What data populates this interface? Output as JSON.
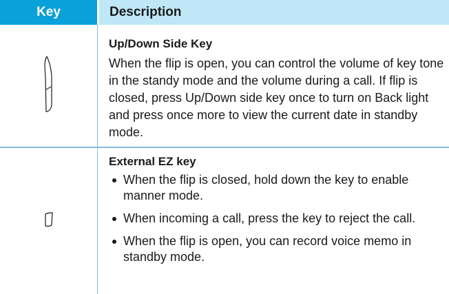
{
  "table": {
    "header": {
      "key": "Key",
      "description": "Description"
    },
    "rows": [
      {
        "icon": "up-down-side-key-icon",
        "title": "Up/Down Side Key",
        "body": "When the flip is open, you can control the volume of key tone in the standy mode and the volume during a call. If flip is closed, press Up/Down side key once to turn on Back light and press once more to view the current date in standby mode."
      },
      {
        "icon": "external-ez-key-icon",
        "title": "External EZ key",
        "bullets": [
          "When the flip is closed, hold down the key to enable manner mode.",
          "When incoming a call, press the key to reject the call.",
          "When the flip is open, you can record voice memo in standby mode."
        ]
      }
    ]
  },
  "colors": {
    "header_key_bg": "#0aa0d9",
    "header_desc_bg": "#bfe7f7",
    "divider": "#7fbcd9"
  }
}
